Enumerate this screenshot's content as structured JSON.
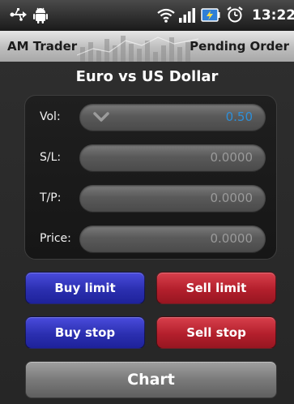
{
  "status_bar": {
    "time": "13:22",
    "icons": [
      "usb-icon",
      "android-debug-icon",
      "wifi-icon",
      "signal-icon",
      "battery-icon",
      "alarm-icon"
    ]
  },
  "header": {
    "app_title": "AM Trader",
    "mode": "Pending Order"
  },
  "instrument": {
    "title": "Euro vs US Dollar"
  },
  "form": {
    "fields": [
      {
        "label": "Vol:",
        "value": "0.50"
      },
      {
        "label": "S/L:",
        "value": "0.0000"
      },
      {
        "label": "T/P:",
        "value": "0.0000"
      },
      {
        "label": "Price:",
        "value": "0.0000"
      }
    ]
  },
  "buttons": {
    "buy_limit": "Buy limit",
    "sell_limit": "Sell limit",
    "buy_stop": "Buy stop",
    "sell_stop": "Sell stop",
    "chart": "Chart"
  },
  "colors": {
    "buy": "#2b2fb0",
    "sell": "#b31f2c",
    "vol_value": "#2e8fd8",
    "placeholder_value": "#9a9a9a"
  }
}
